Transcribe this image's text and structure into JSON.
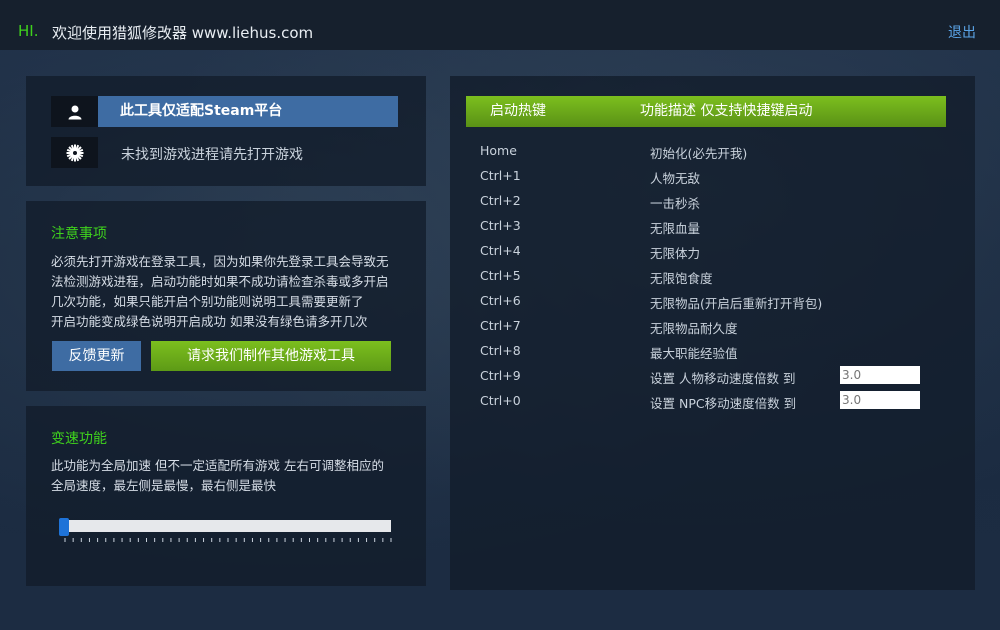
{
  "header": {
    "hi": "HI.",
    "welcome": "欢迎使用猎狐修改器 www.liehus.com",
    "logout": "退出"
  },
  "info": {
    "platform": "此工具仅适配Steam平台",
    "status": "未找到游戏进程请先打开游戏",
    "icons": [
      "user-icon",
      "gear-icon"
    ]
  },
  "notice": {
    "title": "注意事项",
    "lines": [
      "必须先打开游戏在登录工具，因为如果你先登录工具会导致无",
      "法检测游戏进程，启动功能时如果不成功请检查杀毒或多开启",
      "几次功能，如果只能开启个别功能则说明工具需要更新了",
      "开启功能变成绿色说明开启成功 如果没有绿色请多开几次"
    ],
    "feedback_button": "反馈更新",
    "request_button": "请求我们制作其他游戏工具"
  },
  "speed": {
    "title": "变速功能",
    "lines": [
      "此功能为全局加速 但不一定适配所有游戏 左右可调整相应的",
      "全局速度，最左侧是最慢，最右侧是最快"
    ],
    "slider_value_fraction": 0.0
  },
  "hotkeys": {
    "header_key": "启动热键",
    "header_desc": "功能描述 仅支持快捷键启动",
    "rows": [
      {
        "key": "Home",
        "desc": "初始化(必先开我)"
      },
      {
        "key": "Ctrl+1",
        "desc": "人物无敌"
      },
      {
        "key": "Ctrl+2",
        "desc": "一击秒杀"
      },
      {
        "key": "Ctrl+3",
        "desc": "无限血量"
      },
      {
        "key": "Ctrl+4",
        "desc": "无限体力"
      },
      {
        "key": "Ctrl+5",
        "desc": "无限饱食度"
      },
      {
        "key": "Ctrl+6",
        "desc": "无限物品(开启后重新打开背包)"
      },
      {
        "key": "Ctrl+7",
        "desc": "无限物品耐久度"
      },
      {
        "key": "Ctrl+8",
        "desc": "最大职能经验值"
      },
      {
        "key": "Ctrl+9",
        "desc": "设置 人物移动速度倍数 到",
        "input_placeholder": "3.0"
      },
      {
        "key": "Ctrl+0",
        "desc": "设置 NPC移动速度倍数 到",
        "input_placeholder": "3.0"
      }
    ]
  },
  "colors": {
    "accent_green": "#3fd11d",
    "accent_blue": "#3e6ca3",
    "link_blue": "#5aa3e6",
    "slider_blue": "#1e73d8"
  }
}
